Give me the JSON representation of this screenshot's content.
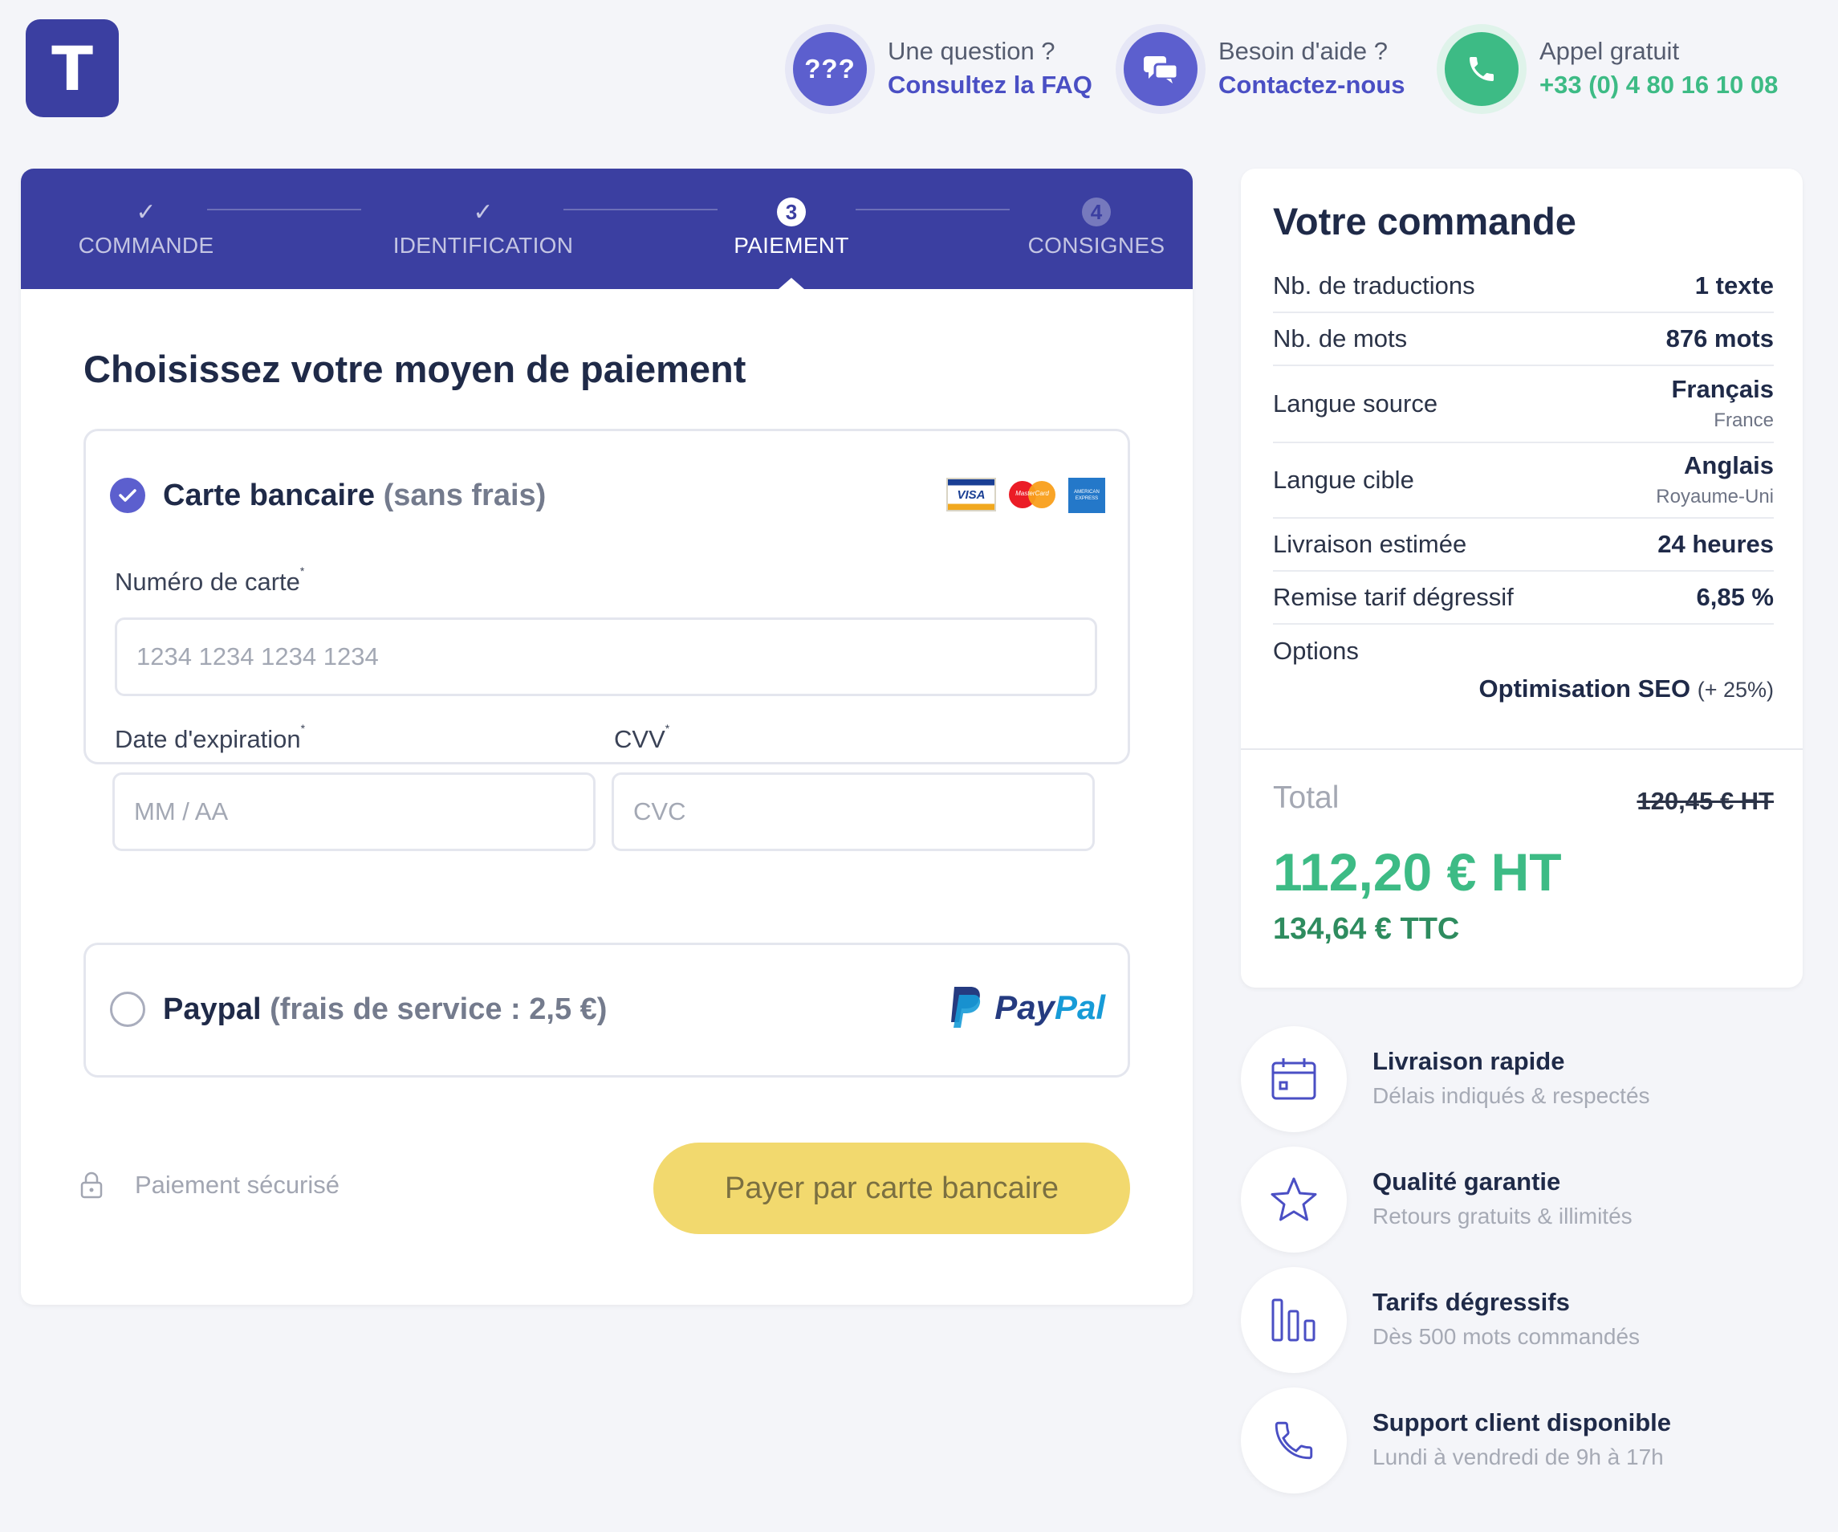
{
  "logo": {
    "letter": "T"
  },
  "header": {
    "faq": {
      "question": "Une question ?",
      "link": "Consultez la FAQ",
      "icon_text": "???"
    },
    "help": {
      "question": "Besoin d'aide ?",
      "link": "Contactez-nous"
    },
    "call": {
      "question": "Appel gratuit",
      "phone": "+33 (0) 4 80 16 10 08"
    }
  },
  "steps": [
    {
      "label": "COMMANDE",
      "mark": "✓",
      "state": "done"
    },
    {
      "label": "IDENTIFICATION",
      "mark": "✓",
      "state": "done"
    },
    {
      "label": "PAIEMENT",
      "mark": "3",
      "state": "active"
    },
    {
      "label": "CONSIGNES",
      "mark": "4",
      "state": "upcoming"
    }
  ],
  "payment": {
    "title": "Choisissez votre moyen de paiement",
    "card_option": {
      "label": "Carte bancaire",
      "sub": "(sans frais)",
      "selected": true,
      "brands": [
        "VISA",
        "MasterCard",
        "AMERICAN EXPRESS"
      ]
    },
    "card_number": {
      "label": "Numéro de carte",
      "required": "*",
      "placeholder": "1234 1234 1234 1234"
    },
    "expiry": {
      "label": "Date d'expiration",
      "required": "*",
      "placeholder": "MM / AA"
    },
    "cvv": {
      "label": "CVV",
      "required": "*",
      "placeholder": "CVC"
    },
    "paypal_option": {
      "label": "Paypal",
      "sub": "(frais de service : 2,5 €)",
      "selected": false,
      "logo_text": "PayPal",
      "logo_pay": "Pay",
      "logo_pal": "Pal"
    },
    "secure_label": "Paiement sécurisé",
    "pay_button": "Payer par carte bancaire"
  },
  "order": {
    "title": "Votre commande",
    "rows": [
      {
        "label": "Nb. de traductions",
        "value": "1 texte"
      },
      {
        "label": "Nb. de mots",
        "value": "876 mots"
      },
      {
        "label": "Langue source",
        "value": "Français",
        "sub": "France"
      },
      {
        "label": "Langue cible",
        "value": "Anglais",
        "sub": "Royaume-Uni"
      },
      {
        "label": "Livraison estimée",
        "value": "24 heures"
      },
      {
        "label": "Remise tarif dégressif",
        "value": "6,85 %"
      },
      {
        "label": "Options",
        "value": ""
      }
    ],
    "option_name": "Optimisation SEO",
    "option_extra": "(+ 25%)",
    "total_label": "Total",
    "old_price": "120,45 € HT",
    "price_ht": "112,20 € HT",
    "price_ttc": "134,64 € TTC"
  },
  "features": [
    {
      "title": "Livraison rapide",
      "sub": "Délais indiqués & respectés",
      "icon": "calendar-icon"
    },
    {
      "title": "Qualité garantie",
      "sub": "Retours gratuits & illimités",
      "icon": "star-icon"
    },
    {
      "title": "Tarifs dégressifs",
      "sub": "Dès 500 mots commandés",
      "icon": "bars-chart-icon"
    },
    {
      "title": "Support client disponible",
      "sub": "Lundi à vendredi de 9h à 17h",
      "icon": "phone-icon"
    }
  ],
  "colors": {
    "primary": "#3b3fa1",
    "accent": "#5c5fce",
    "green": "#3dbb85",
    "button": "#f2d96e"
  }
}
